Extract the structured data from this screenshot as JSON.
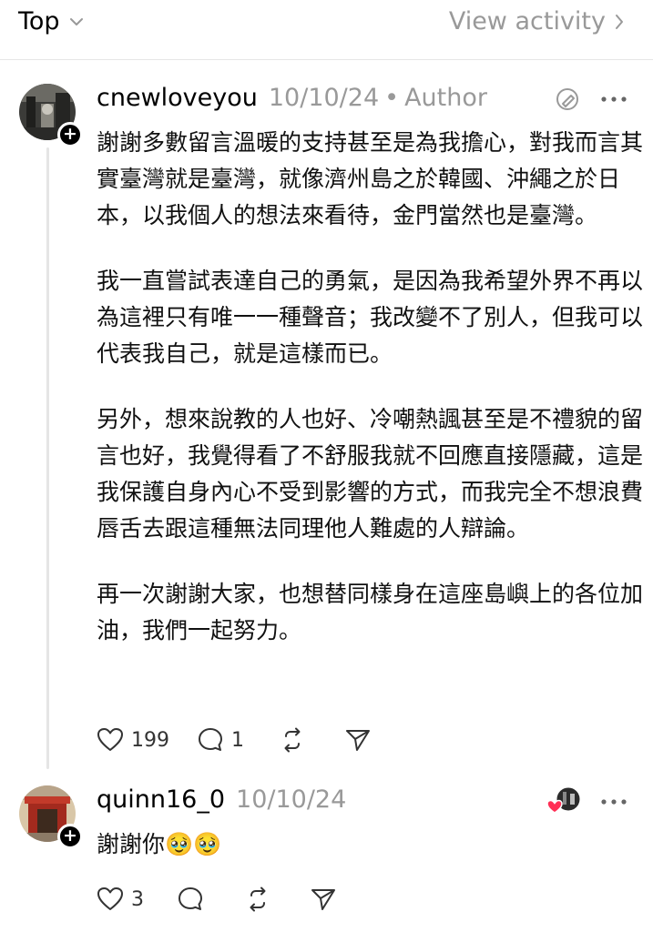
{
  "header": {
    "sort_label": "Top",
    "view_activity_label": "View activity"
  },
  "posts": [
    {
      "username": "cnewloveyou",
      "timestamp": "10/10/24",
      "separator": "•",
      "author_tag": "Author",
      "paragraphs": [
        "謝謝多數留言溫暖的支持甚至是為我擔心，對我而言其實臺灣就是臺灣，就像濟州島之於韓國、沖繩之於日本，以我個人的想法來看待，金門當然也是臺灣。",
        "我一直嘗試表達自己的勇氣，是因為我希望外界不再以為這裡只有唯一一種聲音；我改變不了別人，但我可以代表我自己，就是這樣而已。",
        "另外，想來說教的人也好、冷嘲熱諷甚至是不禮貌的留言也好，我覺得看了不舒服我就不回應直接隱藏，這是我保護自身內心不受到影響的方式，而我完全不想浪費唇舌去跟這種無法同理他人難處的人辯論。",
        "再一次謝謝大家，也想替同樣身在這座島嶼上的各位加油，我們一起努力。"
      ],
      "likes": "199",
      "replies": "1"
    },
    {
      "username": "quinn16_0",
      "timestamp": "10/10/24",
      "text": "謝謝你🥹🥹",
      "likes": "3"
    }
  ],
  "colors": {
    "muted": "#999999",
    "like_heart": "#ff2f55",
    "divider": "#e6e6e6"
  },
  "icons": [
    "chevron-down-icon",
    "chevron-right-icon",
    "plus-icon",
    "edit-icon",
    "more-icon",
    "heart-icon",
    "comment-icon",
    "repost-icon",
    "share-icon"
  ]
}
